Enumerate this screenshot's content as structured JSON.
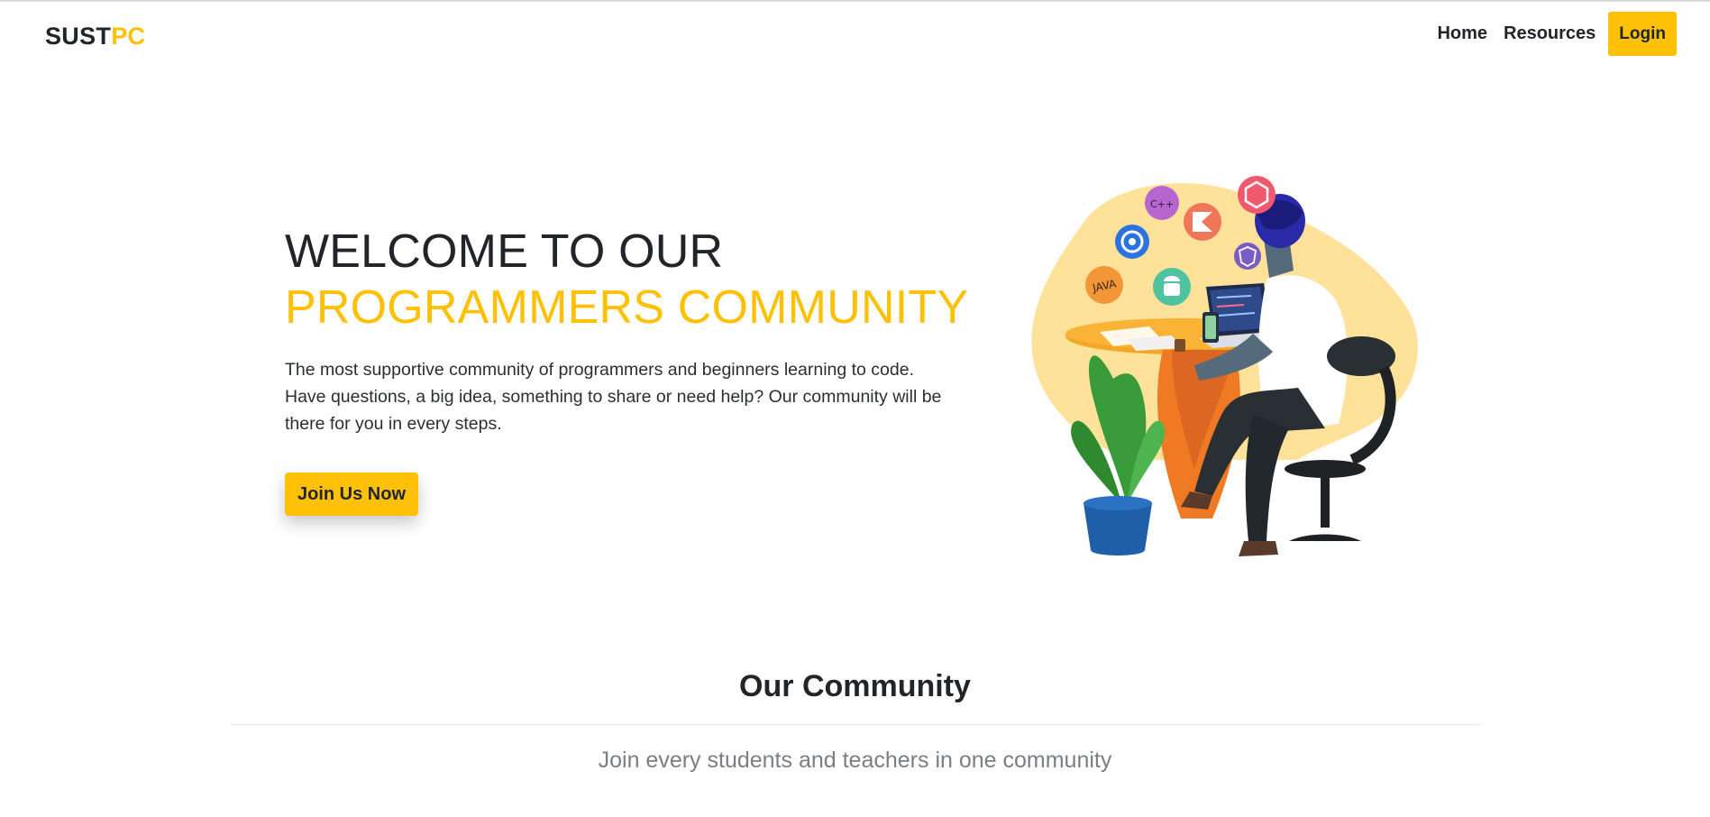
{
  "navbar": {
    "brand_part1": "SUST",
    "brand_part2": "PC",
    "links": [
      "Home",
      "Resources"
    ],
    "login_label": "Login"
  },
  "hero": {
    "title_line1": "WELCOME TO OUR",
    "title_line2": "PROGRAMMERS COMMUNITY",
    "description": "The most supportive community of programmers and beginners learning to code. Have questions, a big idea, something to share or need help? Our community will be there for you in every steps.",
    "cta_label": "Join Us Now",
    "illustration_badges": [
      "C++",
      "JAVA"
    ]
  },
  "community": {
    "title": "Our Community",
    "subtitle": "Join every students and teachers in one community"
  },
  "colors": {
    "accent": "#ffc107",
    "text_dark": "#212529",
    "muted": "#7a7f85"
  },
  "icons": [
    "cplusplus-icon",
    "kotlin-icon",
    "nodejs-icon",
    "ionic-icon",
    "angular-icon",
    "java-icon",
    "android-icon"
  ]
}
